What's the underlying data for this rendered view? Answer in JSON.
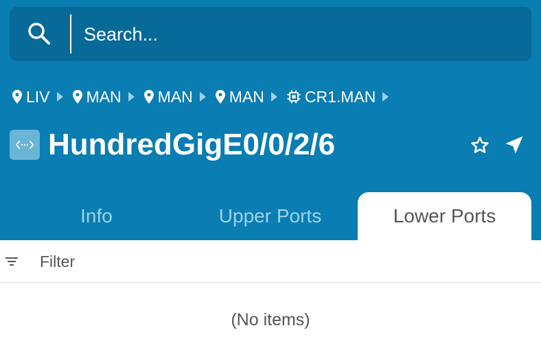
{
  "search": {
    "placeholder": "Search..."
  },
  "breadcrumb": [
    {
      "label": "LIV",
      "icon": "location-pin-icon"
    },
    {
      "label": "MAN",
      "icon": "location-pin-icon"
    },
    {
      "label": "MAN",
      "icon": "location-pin-icon"
    },
    {
      "label": "MAN",
      "icon": "location-pin-icon"
    },
    {
      "label": "CR1.MAN",
      "icon": "chip-icon"
    }
  ],
  "page": {
    "title": "HundredGigE0/0/2/6",
    "icon": "port-arrows-icon"
  },
  "actions": {
    "favorite_icon": "star-outline-icon",
    "navigate_icon": "navigation-arrow-icon"
  },
  "tabs": [
    {
      "label": "Info",
      "active": false
    },
    {
      "label": "Upper Ports",
      "active": false
    },
    {
      "label": "Lower Ports",
      "active": true
    }
  ],
  "filter": {
    "placeholder": "Filter",
    "icon": "filter-lines-icon"
  },
  "list": {
    "empty_text": "(No items)"
  },
  "colors": {
    "header": "#0a7db2",
    "search_bg": "#086a98",
    "tab_inactive_text": "#9fd3ea",
    "text_muted": "#555555"
  }
}
